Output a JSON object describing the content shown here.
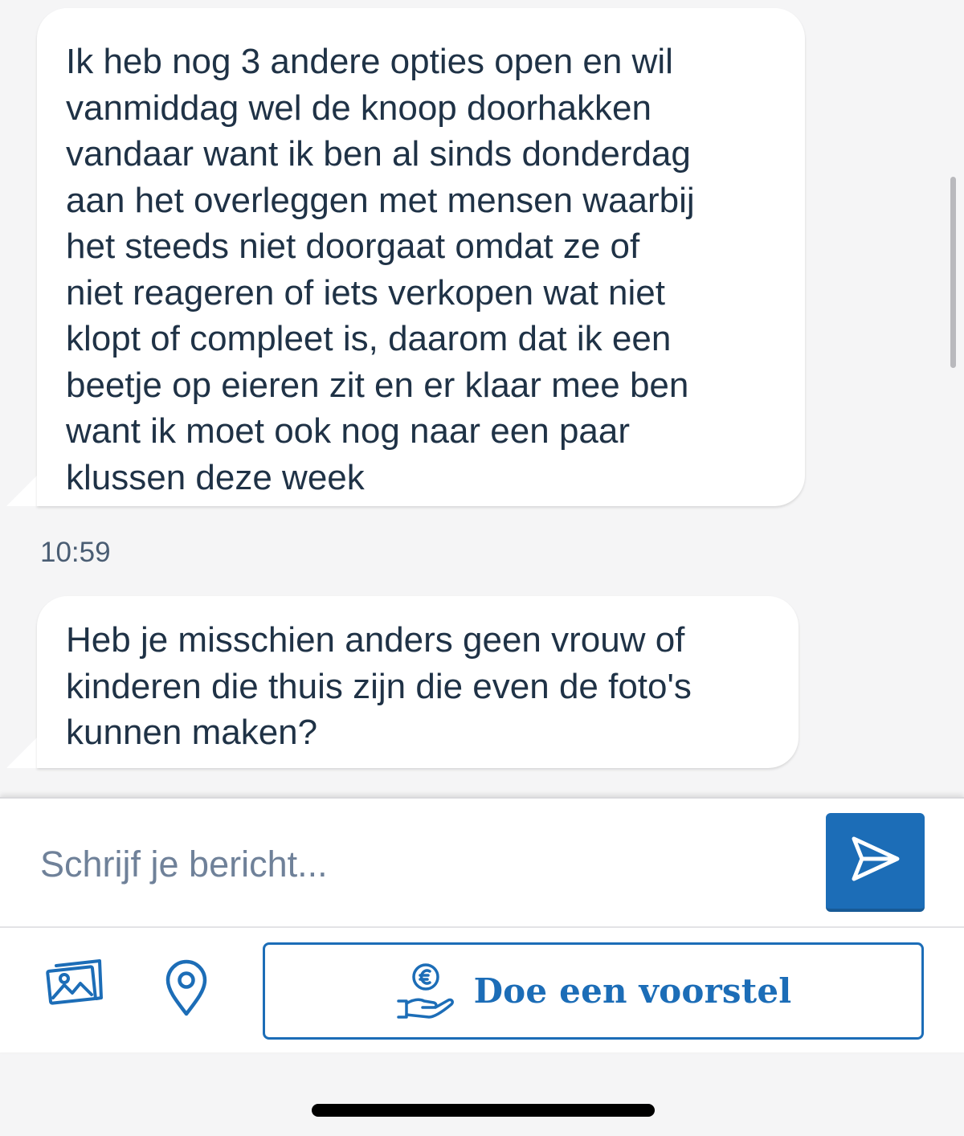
{
  "messages": [
    {
      "text": "Ik heb nog 3 andere opties open en wil\nvanmiddag wel de knoop doorhakken\nvandaar want ik ben al sinds donderdag\naan het overleggen met mensen waarbij\nhet steeds niet doorgaat omdat ze of\nniet reageren of iets verkopen wat niet\nklopt of compleet is, daarom dat ik een\nbeetje op eieren zit en er klaar mee ben\nwant ik moet ook nog naar een paar\nklussen deze week"
    },
    {
      "timestamp": "10:59",
      "text": "Heb je misschien anders geen vrouw of\nkinderen die thuis zijn die even de foto's\nkunnen maken?"
    }
  ],
  "composer": {
    "placeholder": "Schrijf je bericht...",
    "value": ""
  },
  "actions": {
    "send_icon": "send-icon",
    "photo_icon": "photo-gallery-icon",
    "location_icon": "location-pin-icon",
    "offer_icon": "hand-euro-coin-icon",
    "offer_label": "Doe een voorstel"
  },
  "colors": {
    "accent": "#1c6db7",
    "text": "#1f3246",
    "background": "#f5f5f6",
    "bubble": "#ffffff"
  }
}
